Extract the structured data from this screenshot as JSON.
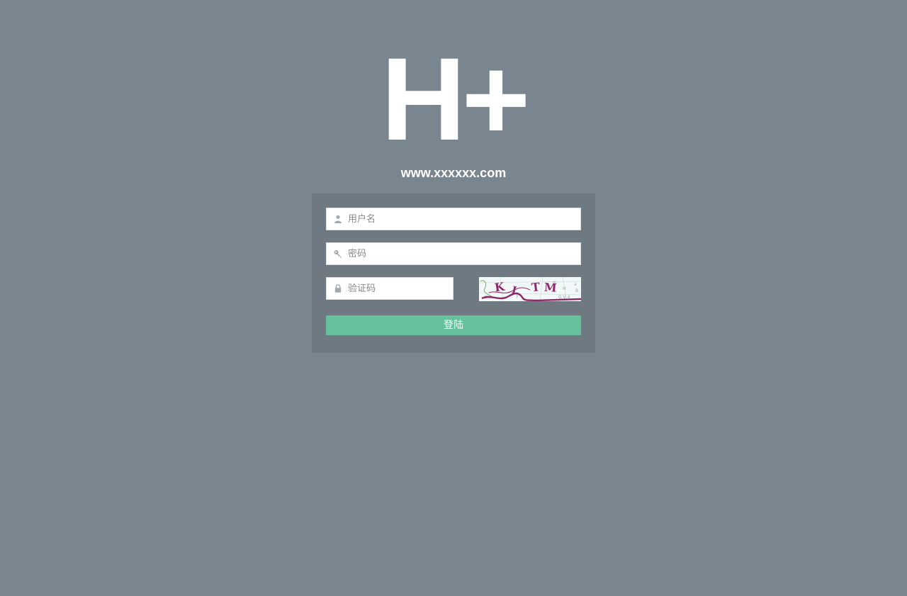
{
  "logo": {
    "text": "H+"
  },
  "site": {
    "url": "www.xxxxxx.com"
  },
  "form": {
    "username": {
      "placeholder": "用户名",
      "value": "",
      "icon": "user-icon"
    },
    "password": {
      "placeholder": "密码",
      "value": "",
      "icon": "key-icon"
    },
    "captcha": {
      "placeholder": "验证码",
      "value": "",
      "icon": "lock-icon"
    },
    "captcha_image": {
      "text": "KLTM"
    },
    "submit_label": "登陆"
  },
  "colors": {
    "background": "#7a868f",
    "panel": "#6e7982",
    "button": "#67c19d",
    "captcha_ink": "#8b2a6b"
  }
}
